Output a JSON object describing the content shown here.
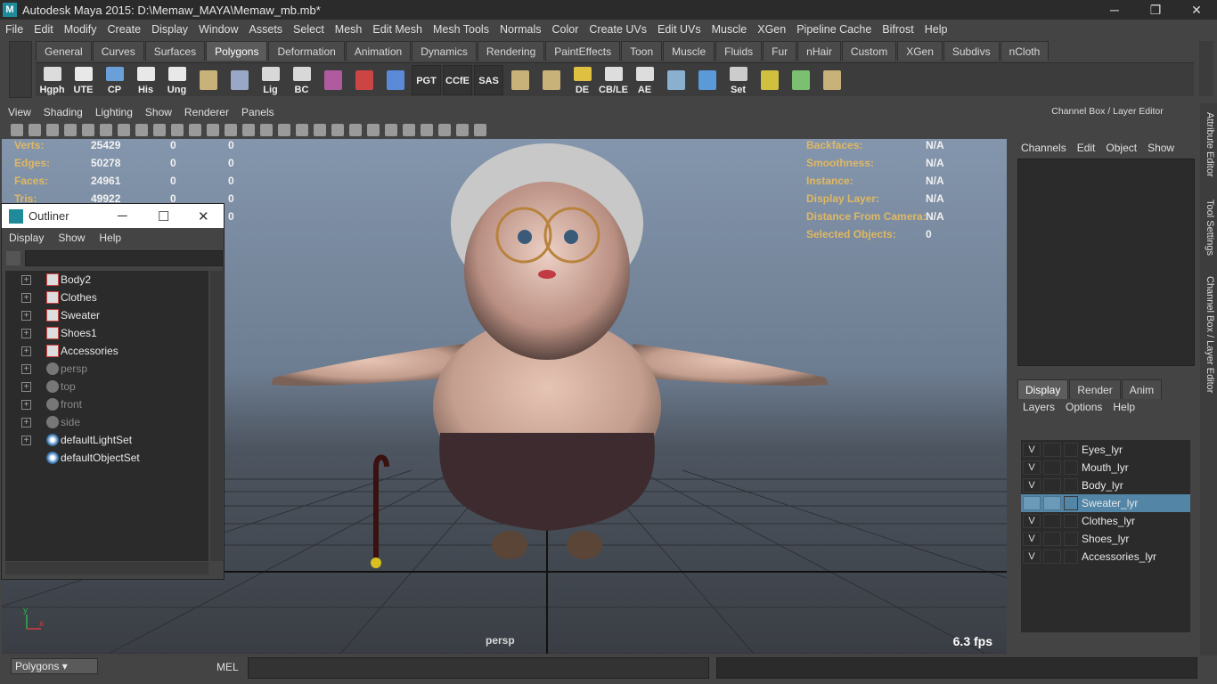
{
  "window": {
    "title": "Autodesk Maya 2015: D:\\Memaw_MAYA\\Memaw_mb.mb*",
    "minimize": "─",
    "restore": "❐",
    "close": "✕"
  },
  "menubar": [
    "File",
    "Edit",
    "Modify",
    "Create",
    "Display",
    "Window",
    "Assets",
    "Select",
    "Mesh",
    "Edit Mesh",
    "Mesh Tools",
    "Normals",
    "Color",
    "Create UVs",
    "Edit UVs",
    "Muscle",
    "XGen",
    "Pipeline Cache",
    "Bifrost",
    "Help"
  ],
  "shelf_tabs": [
    "General",
    "Curves",
    "Surfaces",
    "Polygons",
    "Deformation",
    "Animation",
    "Dynamics",
    "Rendering",
    "PaintEffects",
    "Toon",
    "Muscle",
    "Fluids",
    "Fur",
    "nHair",
    "Custom",
    "XGen",
    "Subdivs",
    "nCloth"
  ],
  "active_shelf_tab": "Polygons",
  "shelf_buttons": [
    {
      "label": "Hgph",
      "style": "icon"
    },
    {
      "label": "UTE",
      "style": "icon"
    },
    {
      "label": "CP",
      "style": "icon"
    },
    {
      "label": "His",
      "style": "icon"
    },
    {
      "label": "Ung",
      "style": "icon"
    },
    {
      "label": "",
      "style": "icon"
    },
    {
      "label": "",
      "style": "icon"
    },
    {
      "label": "Lig",
      "style": "icon"
    },
    {
      "label": "BC",
      "style": "icon"
    },
    {
      "label": "",
      "style": "icon"
    },
    {
      "label": "",
      "style": "icon"
    },
    {
      "label": "",
      "style": "icon"
    },
    {
      "label": "PGT",
      "style": "dark"
    },
    {
      "label": "CCfE",
      "style": "dark"
    },
    {
      "label": "SAS",
      "style": "dark"
    },
    {
      "label": "",
      "style": "icon"
    },
    {
      "label": "",
      "style": "icon"
    },
    {
      "label": "DE",
      "style": "icon"
    },
    {
      "label": "CB/LE",
      "style": "icon"
    },
    {
      "label": "AE",
      "style": "icon"
    },
    {
      "label": "",
      "style": "icon"
    },
    {
      "label": "",
      "style": "icon"
    },
    {
      "label": "Set",
      "style": "icon"
    },
    {
      "label": "",
      "style": "icon"
    },
    {
      "label": "",
      "style": "icon"
    },
    {
      "label": "",
      "style": "icon"
    }
  ],
  "viewport_menu": [
    "View",
    "Shading",
    "Lighting",
    "Show",
    "Renderer",
    "Panels"
  ],
  "hud_left": [
    {
      "label": "Verts:",
      "v1": "25429",
      "v2": "0",
      "v3": "0"
    },
    {
      "label": "Edges:",
      "v1": "50278",
      "v2": "0",
      "v3": "0"
    },
    {
      "label": "Faces:",
      "v1": "24961",
      "v2": "0",
      "v3": "0"
    },
    {
      "label": "Tris:",
      "v1": "49922",
      "v2": "0",
      "v3": "0"
    },
    {
      "label": "",
      "v1": "",
      "v2": "",
      "v3": "0"
    }
  ],
  "hud_right": [
    {
      "label": "Backfaces:",
      "value": "N/A"
    },
    {
      "label": "Smoothness:",
      "value": "N/A"
    },
    {
      "label": "Instance:",
      "value": "N/A"
    },
    {
      "label": "Display Layer:",
      "value": "N/A"
    },
    {
      "label": "Distance From Camera:",
      "value": "N/A"
    },
    {
      "label": "Selected Objects:",
      "value": "0"
    }
  ],
  "camera": "persp",
  "fps": "6.3 fps",
  "axis": {
    "y": "y",
    "x": "x"
  },
  "outliner": {
    "title": "Outliner",
    "menu": [
      "Display",
      "Show",
      "Help"
    ],
    "items": [
      {
        "name": "Body2",
        "type": "mesh",
        "dim": false,
        "expand": true
      },
      {
        "name": "Clothes",
        "type": "mesh",
        "dim": false,
        "expand": true
      },
      {
        "name": "Sweater",
        "type": "mesh",
        "dim": false,
        "expand": true
      },
      {
        "name": "Shoes1",
        "type": "mesh",
        "dim": false,
        "expand": true
      },
      {
        "name": "Accessories",
        "type": "mesh",
        "dim": false,
        "expand": true
      },
      {
        "name": "persp",
        "type": "camera",
        "dim": true,
        "expand": true
      },
      {
        "name": "top",
        "type": "camera",
        "dim": true,
        "expand": true
      },
      {
        "name": "front",
        "type": "camera",
        "dim": true,
        "expand": true
      },
      {
        "name": "side",
        "type": "camera",
        "dim": true,
        "expand": true
      },
      {
        "name": "defaultLightSet",
        "type": "set",
        "dim": false,
        "expand": true
      },
      {
        "name": "defaultObjectSet",
        "type": "set",
        "dim": false,
        "expand": false
      }
    ]
  },
  "channel_box": {
    "title": "Channel Box / Layer Editor",
    "menu": [
      "Channels",
      "Edit",
      "Object",
      "Show"
    ]
  },
  "layer_editor": {
    "tabs": [
      "Display",
      "Render",
      "Anim"
    ],
    "active_tab": "Display",
    "menu": [
      "Layers",
      "Options",
      "Help"
    ],
    "layers": [
      {
        "name": "Eyes_lyr",
        "visible": "V",
        "selected": false
      },
      {
        "name": "Mouth_lyr",
        "visible": "V",
        "selected": false
      },
      {
        "name": "Body_lyr",
        "visible": "V",
        "selected": false
      },
      {
        "name": "Sweater_lyr",
        "visible": "",
        "selected": true
      },
      {
        "name": "Clothes_lyr",
        "visible": "V",
        "selected": false
      },
      {
        "name": "Shoes_lyr",
        "visible": "V",
        "selected": false
      },
      {
        "name": "Accessories_lyr",
        "visible": "V",
        "selected": false
      }
    ]
  },
  "side_tabs": [
    "Attribute Editor",
    "Tool Settings",
    "Channel Box / Layer Editor"
  ],
  "command_line": {
    "menu_set": "Polygons",
    "language": "MEL"
  },
  "colors": {
    "hud_label": "#e0b862",
    "selected_layer": "#5285a6",
    "panel_bg": "#444444",
    "field_bg": "#2b2b2b"
  }
}
